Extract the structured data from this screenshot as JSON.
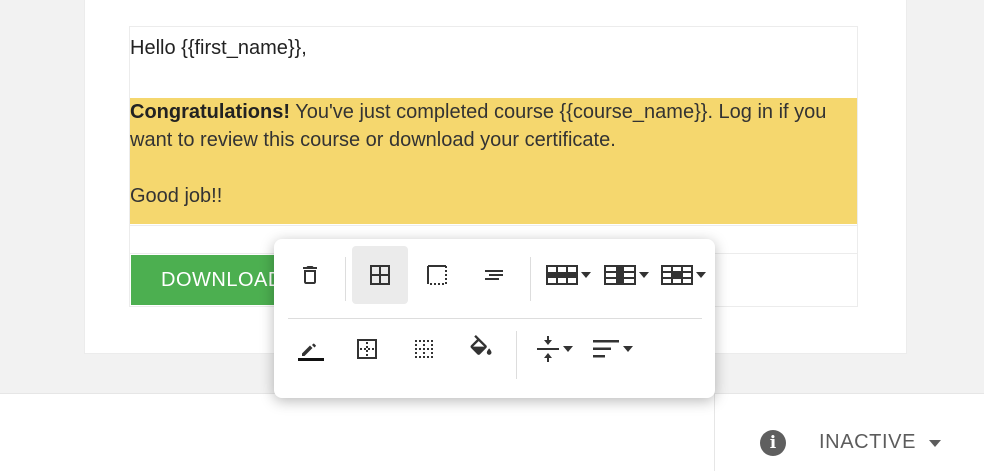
{
  "email": {
    "greeting": "Hello {{first_name}},",
    "highlight_bold": "Congratulations!",
    "highlight_text": " You've just completed course {{course_name}}. Log in if you want to review this course or download your certificate.",
    "sign_off": "Good job!!",
    "button_label": "DOWNLOAD",
    "highlight_color": "#f5d76e",
    "button_color": "#4caf50"
  },
  "toolbar": {
    "row1": [
      {
        "icon": "trash-icon",
        "name": "delete-table-button"
      },
      {
        "icon": "table-grid-icon",
        "name": "table-layout-button",
        "active": true
      },
      {
        "icon": "cell-border-icon",
        "name": "cell-border-button"
      },
      {
        "icon": "align-text-icon",
        "name": "align-text-button"
      },
      {
        "icon": "insert-row-icon",
        "name": "row-menu-button",
        "dropdown": true
      },
      {
        "icon": "insert-column-icon",
        "name": "column-menu-button",
        "dropdown": true
      },
      {
        "icon": "cell-menu-icon",
        "name": "cell-menu-button",
        "dropdown": true
      }
    ],
    "row2": [
      {
        "icon": "pen-color-icon",
        "name": "border-color-button"
      },
      {
        "icon": "border-inner-icon",
        "name": "border-style-button"
      },
      {
        "icon": "border-none-icon",
        "name": "border-none-button"
      },
      {
        "icon": "paint-bucket-icon",
        "name": "background-color-button"
      },
      {
        "icon": "vertical-align-icon",
        "name": "vertical-align-button",
        "dropdown": true
      },
      {
        "icon": "horizontal-align-icon",
        "name": "horizontal-align-button",
        "dropdown": true
      }
    ]
  },
  "status": {
    "label": "INACTIVE",
    "info_icon": "info-icon"
  }
}
